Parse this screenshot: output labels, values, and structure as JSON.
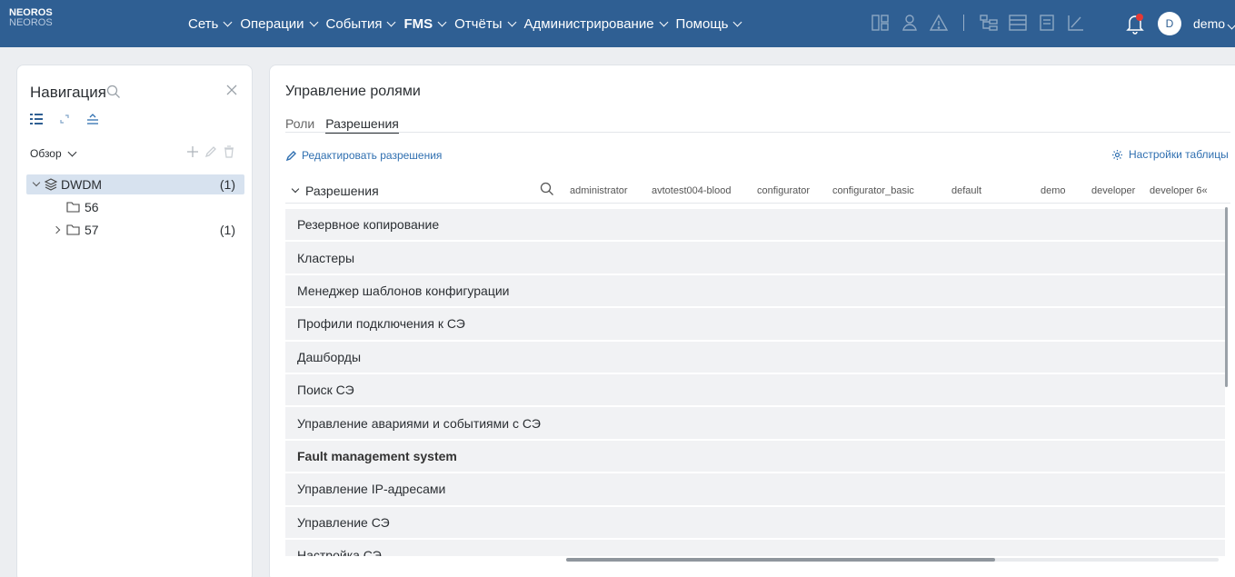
{
  "brand": {
    "name": "NEOROS",
    "subname": "NEOROS"
  },
  "menu": [
    {
      "label": "Сеть",
      "bold": false
    },
    {
      "label": "Операции",
      "bold": false
    },
    {
      "label": "События",
      "bold": false
    },
    {
      "label": "FMS",
      "bold": true
    },
    {
      "label": "Отчёты",
      "bold": false
    },
    {
      "label": "Администрирование",
      "bold": false
    },
    {
      "label": "Помощь",
      "bold": false
    }
  ],
  "user": {
    "initial": "D",
    "name": "demo"
  },
  "colors": {
    "topbar": "#2f5f93",
    "accent": "#2f6fb0",
    "selected": "#d7e2ef",
    "alert": "#e53935"
  },
  "nav": {
    "title": "Навигация",
    "overview_label": "Обзор",
    "tree": [
      {
        "label": "DWDM",
        "count": "(1)",
        "expanded": true,
        "icon": "layers-icon"
      },
      {
        "label": "56",
        "count": "",
        "icon": "folder-icon"
      },
      {
        "label": "57",
        "count": "(1)",
        "icon": "folder-icon"
      }
    ]
  },
  "main": {
    "title": "Управление ролями",
    "tabs": [
      "Роли",
      "Разрешения"
    ],
    "active_tab": "Разрешения",
    "edit_link": "Редактировать разрешения",
    "table_settings": "Настройки таблицы",
    "permissions_header": "Разрешения",
    "columns": [
      "administrator",
      "avtotest004-blood",
      "configurator",
      "configurator_basic",
      "default",
      "demo",
      "developer",
      "developer 6«"
    ],
    "rows": [
      "Резервное копирование",
      "Кластеры",
      "Менеджер шаблонов конфигурации",
      "Профили подключения к СЭ",
      "Дашборды",
      "Поиск СЭ",
      "Управление авариями и событиями с СЭ",
      "Fault management system",
      "Управление IP-адресами",
      "Управление СЭ",
      "Настройка СЭ"
    ]
  }
}
